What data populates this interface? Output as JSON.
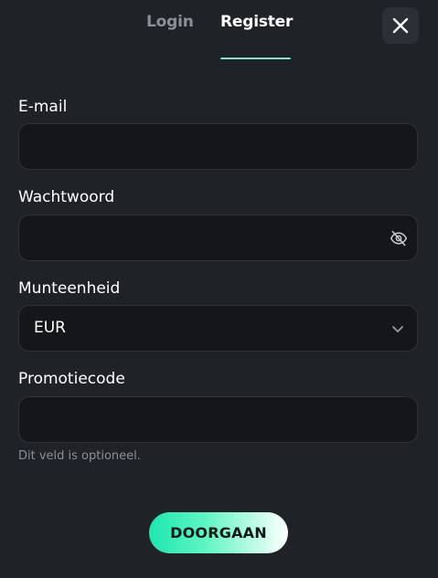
{
  "tabs": {
    "login": "Login",
    "register": "Register",
    "active": "register",
    "accent_color": "#7fe3d3"
  },
  "close": {
    "icon": "close-icon"
  },
  "form": {
    "email": {
      "label": "E-mail",
      "value": "",
      "placeholder": ""
    },
    "password": {
      "label": "Wachtwoord",
      "value": "",
      "placeholder": "",
      "toggle_icon": "eye-off-icon"
    },
    "currency": {
      "label": "Munteenheid",
      "selected": "EUR",
      "icon": "chevron-down-icon"
    },
    "promo": {
      "label": "Promotiecode",
      "value": "",
      "placeholder": "",
      "hint": "Dit veld is optioneel."
    }
  },
  "submit": {
    "label": "DOORGAAN",
    "gradient_start": "#1ee6b0",
    "gradient_end": "#ffffff"
  },
  "colors": {
    "background": "#1f2227",
    "field_background": "#141619",
    "muted_text": "#8a9099"
  }
}
